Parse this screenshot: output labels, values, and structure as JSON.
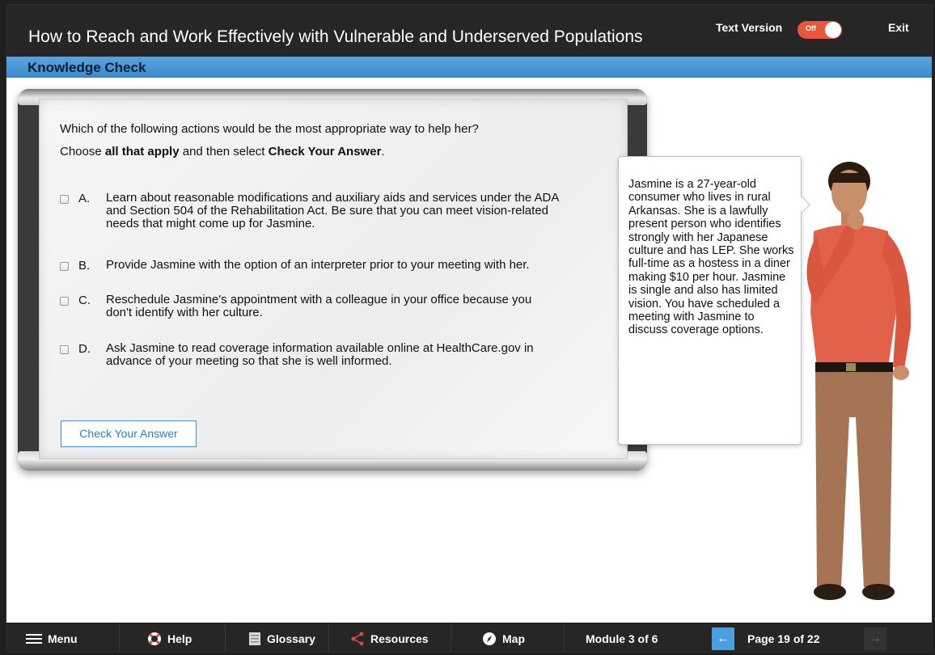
{
  "header": {
    "course_title": "How to Reach and Work Effectively with Vulnerable and Underserved Populations",
    "text_version_label": "Text Version",
    "toggle_state": "Off",
    "exit_label": "Exit"
  },
  "section": {
    "title": "Knowledge Check"
  },
  "question": {
    "prompt": "Which of the following actions would be the most appropriate way to help her?",
    "instruction_prefix": "Choose ",
    "instruction_bold1": "all that apply",
    "instruction_middle": " and then select ",
    "instruction_bold2": "Check Your Answer",
    "instruction_suffix": ".",
    "options": [
      {
        "letter": "A.",
        "text": "Learn about reasonable modifications and auxiliary aids and services under the ADA and Section 504 of the Rehabilitation Act. Be sure that you can meet vision-related needs that might come up for Jasmine.",
        "checked": false
      },
      {
        "letter": "B.",
        "text": "Provide Jasmine with the option of an interpreter prior to your meeting with her.",
        "checked": false
      },
      {
        "letter": "C.",
        "text": "Reschedule Jasmine's appointment with a colleague in your office because you don't identify with her culture.",
        "checked": false
      },
      {
        "letter": "D.",
        "text": "Ask Jasmine to read coverage information available online at HealthCare.gov in advance of your meeting so that she is well informed.",
        "checked": false
      }
    ],
    "check_button_label": "Check Your Answer"
  },
  "bubble": {
    "text": "Jasmine is a 27-year-old consumer who lives in rural Arkansas. She is a lawfully present person who identifies strongly with her Japanese culture and has LEP. She works full-time as a hostess in a diner making $10 per hour. Jasmine is single and also has limited vision. You have scheduled a meeting with Jasmine to discuss coverage options."
  },
  "footer": {
    "menu_label": "Menu",
    "help_label": "Help",
    "glossary_label": "Glossary",
    "resources_label": "Resources",
    "map_label": "Map",
    "module_label": "Module 3 of 6",
    "page_label": "Page 19 of 22",
    "prev_icon": "left-arrow-icon",
    "next_icon": "right-arrow-icon"
  },
  "colors": {
    "header_bg": "#262626",
    "section_bar": "#4a97d6",
    "toggle_off": "#e9563e",
    "accent_blue": "#3e8fcf",
    "shirt": "#e2614a"
  }
}
